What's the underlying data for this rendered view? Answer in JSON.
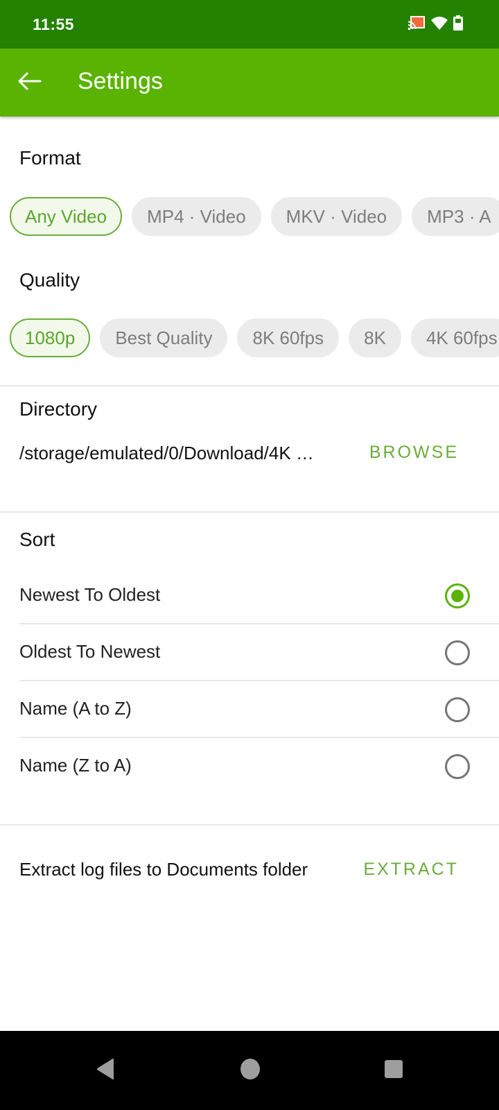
{
  "status_bar": {
    "time": "11:55",
    "icons": [
      "cast-icon",
      "wifi-icon",
      "battery-icon"
    ]
  },
  "app_bar": {
    "back_icon": "arrow-left-icon",
    "title": "Settings"
  },
  "format": {
    "title": "Format",
    "chips": [
      {
        "label": "Any Video",
        "selected": true
      },
      {
        "label": "MP4 · Video",
        "selected": false
      },
      {
        "label": "MKV · Video",
        "selected": false
      },
      {
        "label": "MP3 · A",
        "selected": false
      }
    ]
  },
  "quality": {
    "title": "Quality",
    "chips": [
      {
        "label": "1080p",
        "selected": true
      },
      {
        "label": "Best Quality",
        "selected": false
      },
      {
        "label": "8K 60fps",
        "selected": false
      },
      {
        "label": "8K",
        "selected": false
      },
      {
        "label": "4K 60fps",
        "selected": false
      }
    ]
  },
  "directory": {
    "title": "Directory",
    "path": "/storage/emulated/0/Download/4K …",
    "browse_label": "BROWSE"
  },
  "sort": {
    "title": "Sort",
    "options": [
      {
        "label": "Newest To Oldest",
        "checked": true
      },
      {
        "label": "Oldest To Newest",
        "checked": false
      },
      {
        "label": "Name (A to Z)",
        "checked": false
      },
      {
        "label": "Name (Z to A)",
        "checked": false
      }
    ]
  },
  "extract": {
    "label": "Extract log files to Documents folder",
    "button_label": "EXTRACT"
  },
  "colors": {
    "status_bar": "#248200",
    "app_bar": "#5ab300",
    "accent": "#6aad3a",
    "chip_bg": "#ebebeb",
    "chip_selected_bg": "#f2f8ea"
  },
  "nav_bar": {
    "buttons": [
      "back-triangle-icon",
      "home-circle-icon",
      "recents-square-icon"
    ]
  }
}
